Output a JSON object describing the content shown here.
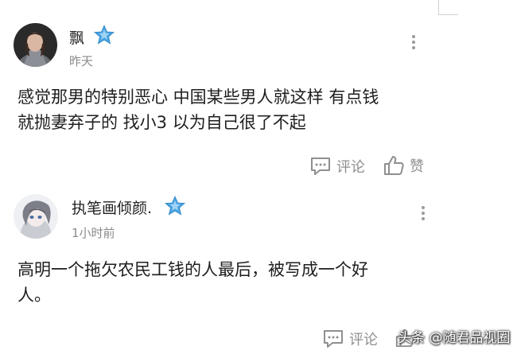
{
  "comments": [
    {
      "username": "飘",
      "time": "昨天",
      "content_lines": [
        "感觉那男的特别恶心 中国某些男人就这样 有点钱",
        "就抛妻弃子的 找小3   以为自己很了不起"
      ],
      "actions": {
        "comment_label": "评论",
        "like_label": "赞"
      }
    },
    {
      "username": "执笔画倾颜.",
      "time": "1小时前",
      "content_lines": [
        "高明一个拖欠农民工钱的人最后，被写成一个好",
        "人。"
      ],
      "actions": {
        "comment_label": "评论"
      }
    }
  ],
  "watermark": "头条 @随君品视圈",
  "colors": {
    "secondary_text": "#8a8a8a",
    "badge_blue": "#4aa3e0"
  },
  "icons": [
    "more-vertical-icon",
    "comment-icon",
    "thumbs-up-icon",
    "verified-star-badge-icon"
  ]
}
